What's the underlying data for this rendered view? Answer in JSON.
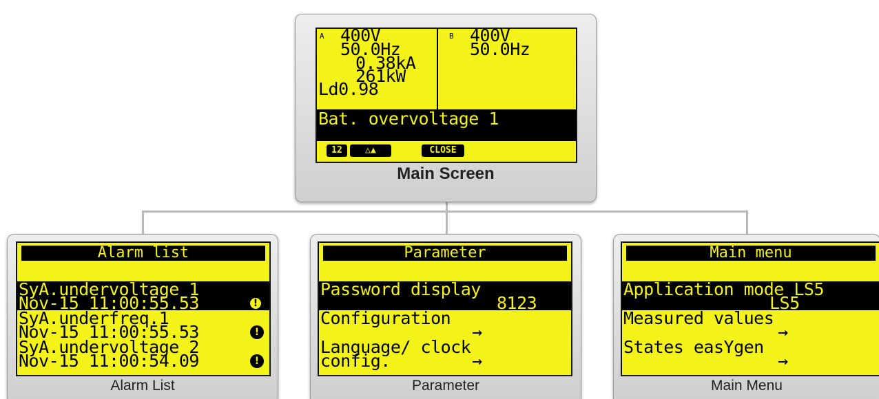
{
  "main_screen": {
    "caption": "Main Screen",
    "gen_a": {
      "tag": "A",
      "voltage": "400V",
      "frequency": "50.0Hz",
      "current": "0.38kA",
      "power": "261kW",
      "power_factor": "Ld0.98"
    },
    "gen_b": {
      "tag": "B",
      "voltage": "400V",
      "frequency": "50.0Hz"
    },
    "alarm_message": "Bat. overvoltage 1",
    "softkeys": {
      "count": "12",
      "nav": "△▲",
      "close": "CLOSE"
    }
  },
  "alarm_list": {
    "caption": "Alarm List",
    "title": "Alarm list",
    "entries": [
      {
        "name": "SyA.undervoltage 1",
        "time": "Nov-15 11:00:55.53",
        "icon": "exclamation-outline-icon"
      },
      {
        "name": "SyA.underfreq.1",
        "time": "Nov-15 11:00:55.53",
        "icon": "exclamation-filled-icon"
      },
      {
        "name": "SyA.undervoltage 2",
        "time": "Nov-15 11:00:54.09",
        "icon": "exclamation-filled-icon"
      }
    ]
  },
  "parameter": {
    "caption": "Parameter",
    "title": "Parameter",
    "items": [
      {
        "label": "Password display",
        "value": "8123"
      },
      {
        "label": "Configuration",
        "value": "→"
      },
      {
        "label": "Language/ clock",
        "label2": "config.",
        "value": "→"
      }
    ]
  },
  "main_menu": {
    "caption": "Main Menu",
    "title": "Main menu",
    "items": [
      {
        "label": "Application mode LS5",
        "value": "LS5"
      },
      {
        "label": "Measured values",
        "value": "→"
      },
      {
        "label": "States easYgen",
        "value": "→"
      }
    ]
  },
  "colors": {
    "lcd_background": "#f3f31a",
    "lcd_text": "#000000",
    "bezel": "#d9d9d9",
    "connector": "#b9b9b9"
  }
}
